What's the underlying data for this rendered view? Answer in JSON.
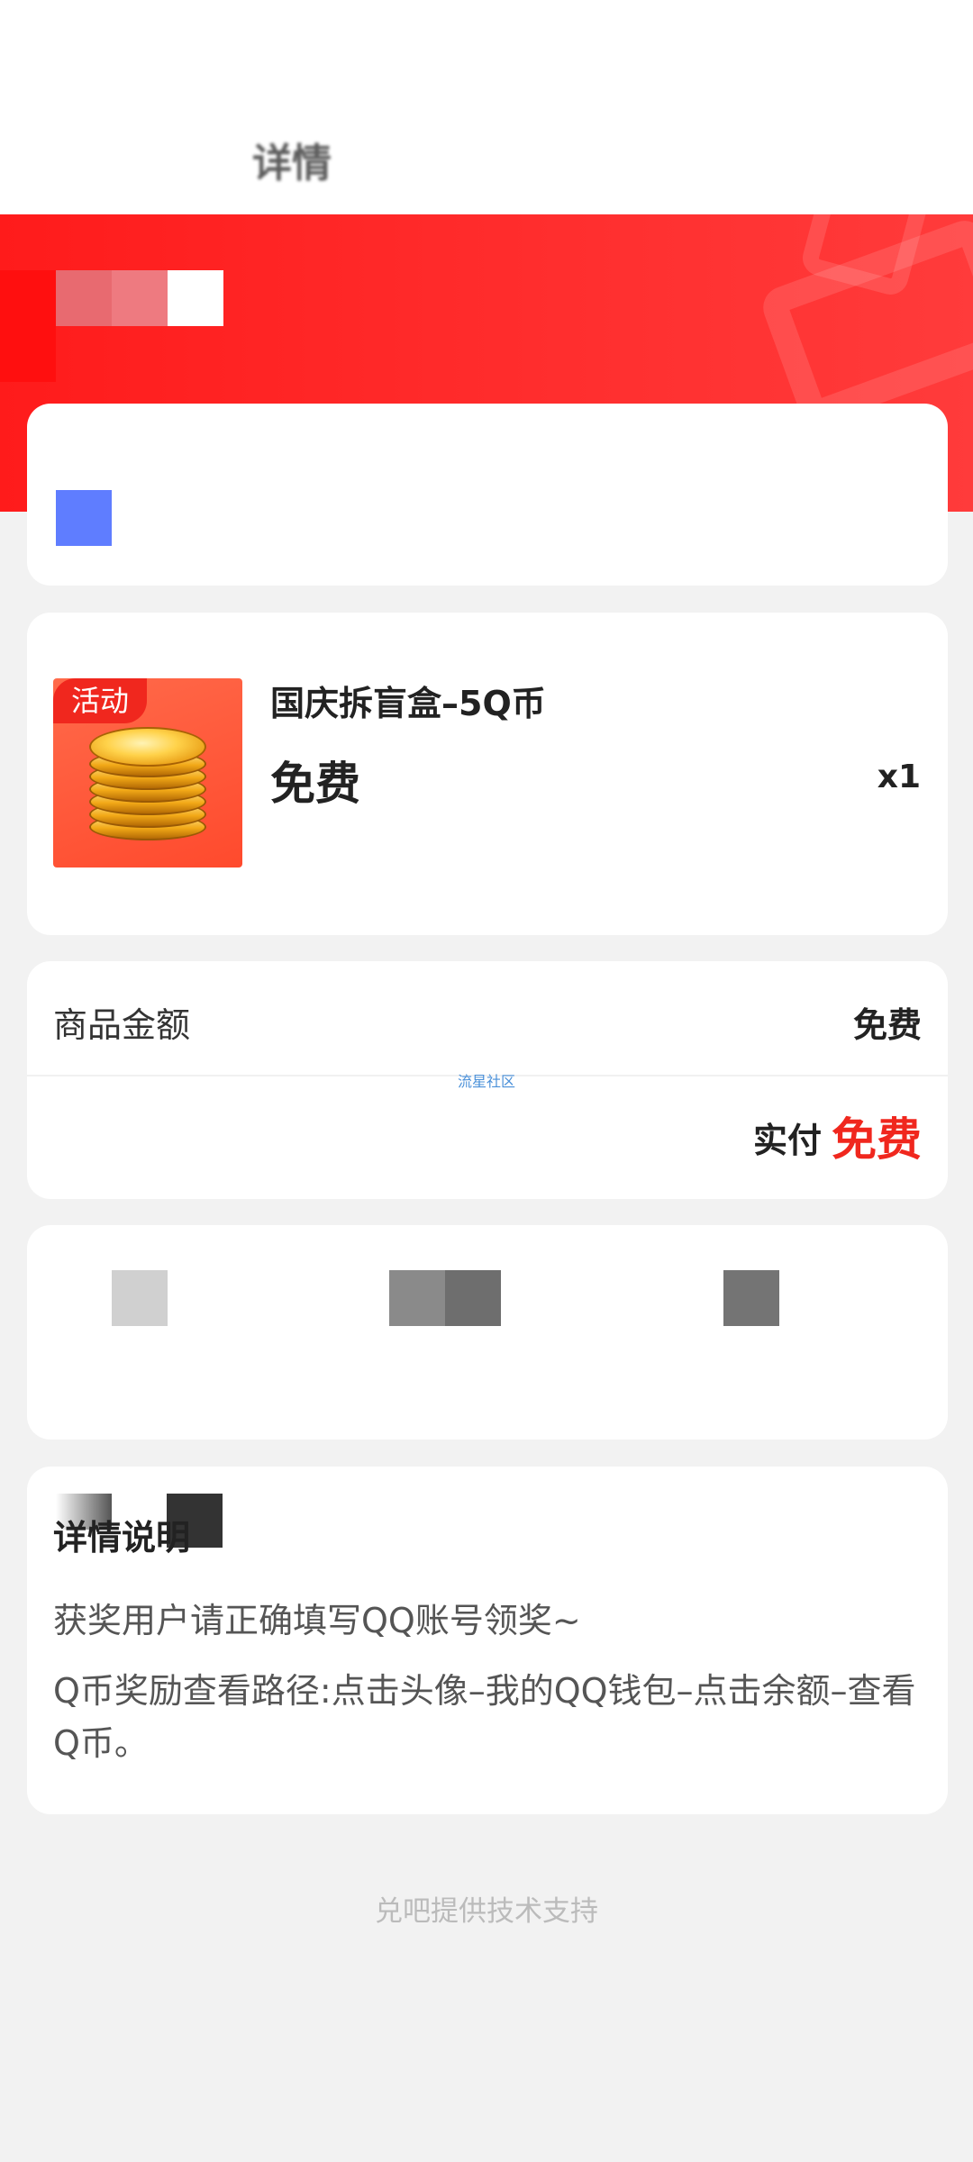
{
  "header": {
    "title": "详情"
  },
  "product": {
    "tag": "活动",
    "name": "国庆拆盲盒–5Q币",
    "price": "免费",
    "quantity": "x1"
  },
  "amount": {
    "label": "商品金额",
    "value": "免费",
    "watermark": "流星社区",
    "paid_label": "实付",
    "paid_value": "免费"
  },
  "description": {
    "title": "详情说明",
    "line1": "获奖用户请正确填写QQ账号领奖~",
    "line2": "Q币奖励查看路径:点击头像–我的QQ钱包–点击余额–查看Q币。"
  },
  "footer": {
    "text": "兑吧提供技术支持"
  },
  "colors": {
    "accent": "#f0271e",
    "hero_red": "#ff2a2a",
    "background": "#f2f2f2"
  }
}
